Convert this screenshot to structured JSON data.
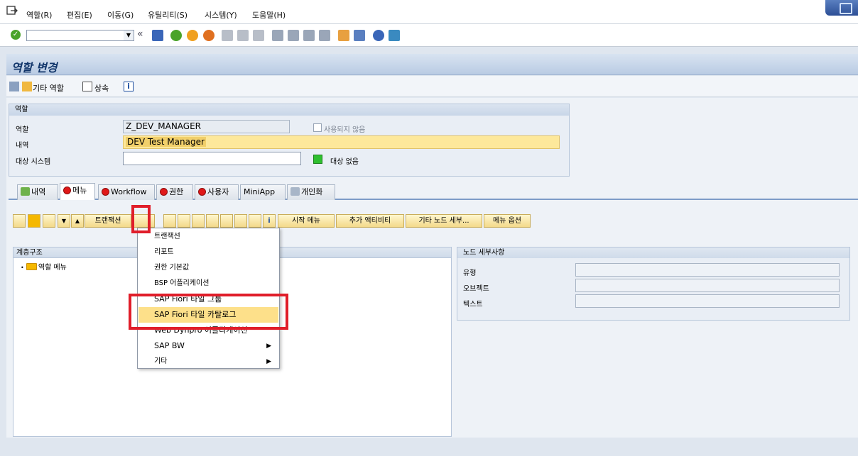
{
  "menubar": {
    "items": [
      "역할(R)",
      "편집(E)",
      "이동(G)",
      "유틸리티(S)",
      "시스템(Y)",
      "도움말(H)"
    ]
  },
  "toolbar": {
    "back_symbol": "«",
    "ok_symbol": "✓"
  },
  "title": "역할 변경",
  "app_toolbar": {
    "other_role": "기타 역할",
    "inherit": "상속"
  },
  "role_group": {
    "header": "역할",
    "role_label": "역할",
    "role_value": "Z_DEV_MANAGER",
    "unused_label": "사용되지 않음",
    "desc_label": "내역",
    "desc_value": "DEV Test Manager",
    "target_label": "대상 시스템",
    "target_value": "",
    "no_target_label": "대상 없음"
  },
  "tabs": [
    "내역",
    "메뉴",
    "Workflow",
    "권한",
    "사용자",
    "MiniApp",
    "개인화"
  ],
  "menu_toolbar": {
    "transaction": "트랜잭션",
    "start_menu": "시작 메뉴",
    "add_activity": "추가 액티비티",
    "other_node_detail": "기타 노드 세부...",
    "menu_options": "메뉴 옵션"
  },
  "hierarchy": {
    "header": "계층구조",
    "root": "역할 메뉴"
  },
  "node_details": {
    "header": "노드 세부사항",
    "type_label": "유형",
    "object_label": "오브젝트",
    "text_label": "텍스트"
  },
  "context_menu": {
    "items": [
      {
        "label": "트랜잭션",
        "has_sub": false
      },
      {
        "label": "리포트",
        "has_sub": false
      },
      {
        "label": "권한 기본값",
        "has_sub": false
      },
      {
        "label": "BSP 어플리케이션",
        "has_sub": false
      },
      {
        "label": "SAP Fiori 타일 그룹",
        "has_sub": false
      },
      {
        "label": "SAP Fiori 타일 카탈로그",
        "has_sub": false,
        "selected": true
      },
      {
        "label": "Web Dynpro 어플리케이션",
        "has_sub": false
      },
      {
        "label": "SAP BW",
        "has_sub": true
      },
      {
        "label": "기타",
        "has_sub": true
      }
    ]
  },
  "colors": {
    "highlight_red": "#e01e2a",
    "selected_item": "#fde08a",
    "accent": "#12366b"
  }
}
